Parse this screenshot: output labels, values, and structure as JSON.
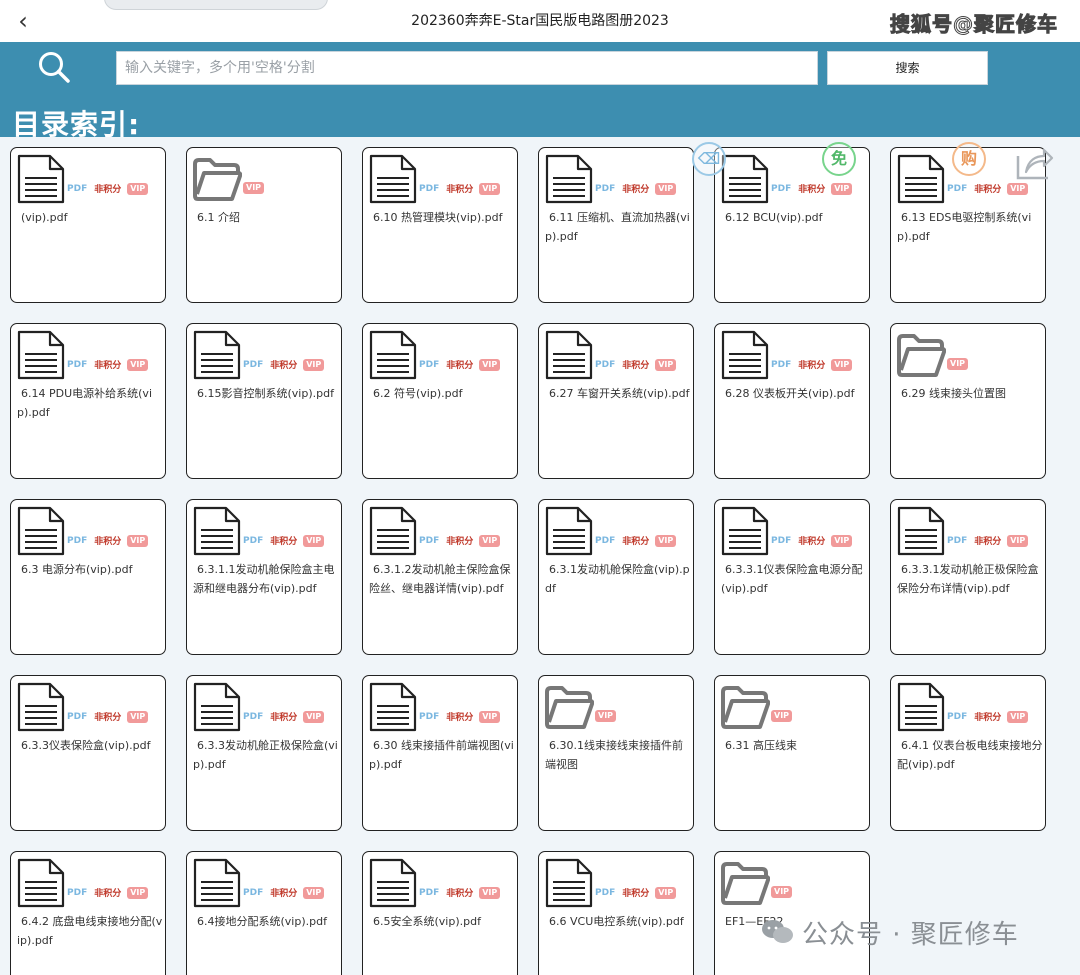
{
  "titlebar": {
    "back_icon": "chevron-left-icon",
    "title": "202360奔奔E-Star国民版电路图册2023",
    "watermark": "搜狐号@聚匠修车"
  },
  "search": {
    "icon": "search-icon",
    "placeholder": "输入关键字，多个用'空格'分割",
    "value": "",
    "button_label": "搜索"
  },
  "index": {
    "heading": "目录索引:"
  },
  "badges": {
    "pdf": "PDF",
    "points": "非积分",
    "vip": "VIP"
  },
  "hover_actions": {
    "delete": "⌫",
    "free": "免",
    "buy": "购",
    "share_icon": "share-icon"
  },
  "items": [
    {
      "type": "pdf",
      "name": "(vip).pdf"
    },
    {
      "type": "folder",
      "name": "6.1 介绍"
    },
    {
      "type": "pdf",
      "name": "6.10 热管理模块(vip).pdf"
    },
    {
      "type": "pdf",
      "name": "6.11 压缩机、直流加热器(vip).pdf"
    },
    {
      "type": "pdf",
      "name": "6.12 BCU(vip).pdf"
    },
    {
      "type": "pdf",
      "name": "6.13 EDS电驱控制系统(vip).pdf"
    },
    {
      "type": "pdf",
      "name": "6.14 PDU电源补给系统(vip).pdf"
    },
    {
      "type": "pdf",
      "name": "6.15影音控制系统(vip).pdf"
    },
    {
      "type": "pdf",
      "name": "6.2 符号(vip).pdf"
    },
    {
      "type": "pdf",
      "name": "6.27 车窗开关系统(vip).pdf"
    },
    {
      "type": "pdf",
      "name": "6.28 仪表板开关(vip).pdf"
    },
    {
      "type": "folder",
      "name": "6.29 线束接头位置图"
    },
    {
      "type": "pdf",
      "name": "6.3 电源分布(vip).pdf"
    },
    {
      "type": "pdf",
      "name": "6.3.1.1发动机舱保险盒主电源和继电器分布(vip).pdf"
    },
    {
      "type": "pdf",
      "name": "6.3.1.2发动机舱主保险盒保险丝、继电器详情(vip).pdf"
    },
    {
      "type": "pdf",
      "name": "6.3.1发动机舱保险盒(vip).pdf"
    },
    {
      "type": "pdf",
      "name": "6.3.3.1仪表保险盒电源分配(vip).pdf"
    },
    {
      "type": "pdf",
      "name": "6.3.3.1发动机舱正极保险盒保险分布详情(vip).pdf"
    },
    {
      "type": "pdf",
      "name": "6.3.3仪表保险盒(vip).pdf"
    },
    {
      "type": "pdf",
      "name": "6.3.3发动机舱正极保险盒(vip).pdf"
    },
    {
      "type": "pdf",
      "name": "6.30 线束接插件前端视图(vip).pdf"
    },
    {
      "type": "folder",
      "name": "6.30.1线束接线束接插件前端视图"
    },
    {
      "type": "folder",
      "name": "6.31 高压线束"
    },
    {
      "type": "pdf",
      "name": "6.4.1 仪表台板电线束接地分配(vip).pdf"
    },
    {
      "type": "pdf",
      "name": "6.4.2 底盘电线束接地分配(vip).pdf"
    },
    {
      "type": "pdf",
      "name": "6.4接地分配系统(vip).pdf"
    },
    {
      "type": "pdf",
      "name": "6.5安全系统(vip).pdf"
    },
    {
      "type": "pdf",
      "name": "6.6 VCU电控系统(vip).pdf"
    },
    {
      "type": "folder",
      "name": "EF1—EF22"
    }
  ],
  "watermark_bottom": {
    "text": "公众号 · 聚匠修车",
    "logo_icon": "wechat-icon"
  },
  "colors": {
    "header_bar": "#3d8eb0",
    "background": "#f0f5f9",
    "pdf_badge": "#7bb7e0",
    "vip_badge": "#f19a9a"
  }
}
